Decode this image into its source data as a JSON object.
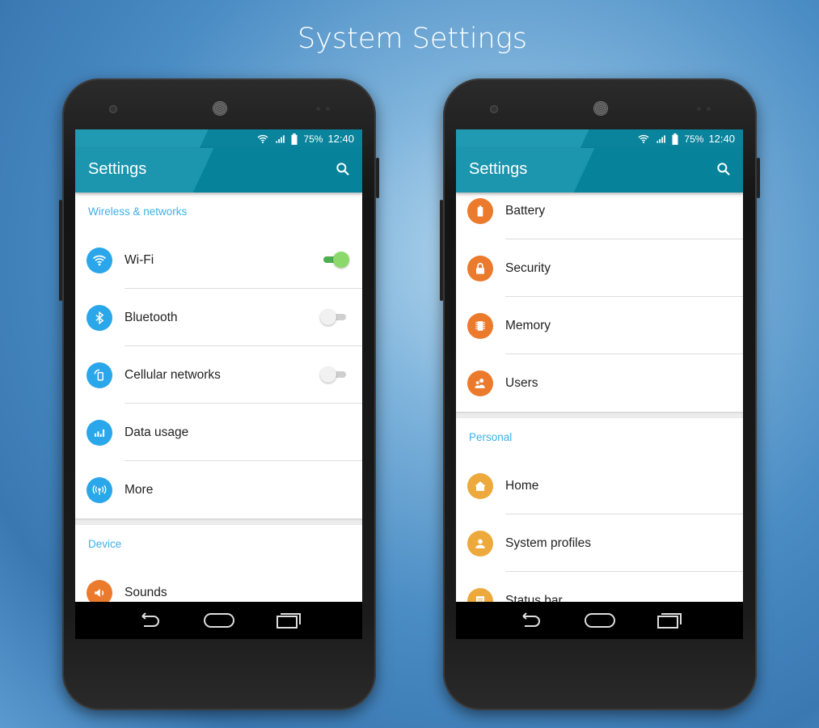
{
  "title": "System Settings",
  "colors": {
    "toolbar": "#06839b",
    "section": "#3fb0e6",
    "blue_icon": "#2aa6ea",
    "orange_icon": "#ec7a2d",
    "amber_icon": "#eda93c",
    "toggle_on": "#8cd96b"
  },
  "phones": [
    {
      "status": {
        "battery": "75%",
        "time": "12:40"
      },
      "toolbar_title": "Settings",
      "offset": 0,
      "sections": [
        {
          "header": "Wireless & networks",
          "items": [
            {
              "label": "Wi-Fi",
              "icon": "wifi-icon",
              "color": "#2aa6ea",
              "toggle": true
            },
            {
              "label": "Bluetooth",
              "icon": "bluetooth-icon",
              "color": "#2aa6ea",
              "toggle": false
            },
            {
              "label": "Cellular networks",
              "icon": "cellular-icon",
              "color": "#2aa6ea",
              "toggle": false
            },
            {
              "label": "Data usage",
              "icon": "data-usage-icon",
              "color": "#2aa6ea"
            },
            {
              "label": "More",
              "icon": "more-wireless-icon",
              "color": "#2aa6ea"
            }
          ]
        },
        {
          "header": "Device",
          "items": [
            {
              "label": "Sounds",
              "icon": "sound-icon",
              "color": "#ec7a2d"
            }
          ]
        }
      ]
    },
    {
      "status": {
        "battery": "75%",
        "time": "12:40"
      },
      "toolbar_title": "Settings",
      "offset": -13,
      "sections": [
        {
          "header": "",
          "items": [
            {
              "label": "Battery",
              "icon": "battery-icon",
              "color": "#ec7a2d"
            },
            {
              "label": "Security",
              "icon": "lock-icon",
              "color": "#ec7a2d"
            },
            {
              "label": "Memory",
              "icon": "memory-chip-icon",
              "color": "#ec7a2d"
            },
            {
              "label": "Users",
              "icon": "users-icon",
              "color": "#ec7a2d"
            }
          ]
        },
        {
          "header": "Personal",
          "items": [
            {
              "label": "Home",
              "icon": "home-icon",
              "color": "#eda93c"
            },
            {
              "label": "System profiles",
              "icon": "profile-icon",
              "color": "#eda93c"
            },
            {
              "label": "Status bar",
              "icon": "status-bar-icon",
              "color": "#eda93c"
            }
          ]
        }
      ]
    }
  ]
}
